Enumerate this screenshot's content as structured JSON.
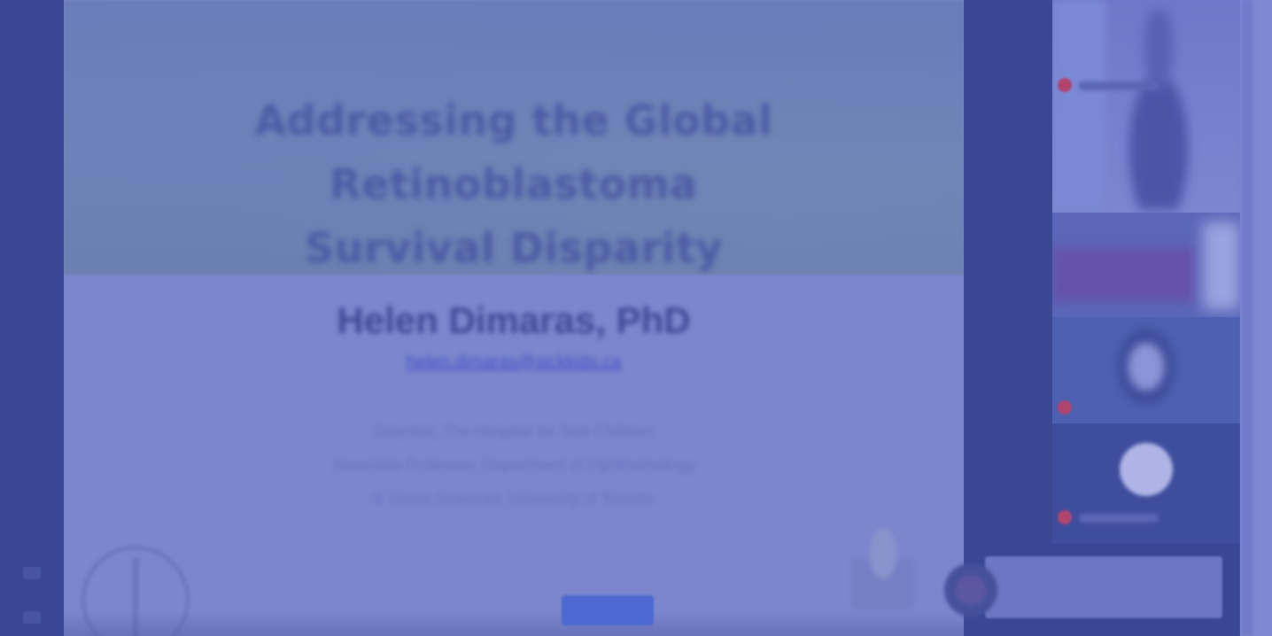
{
  "slide": {
    "title": "Addressing the Global Retinoblastoma Survival Disparity",
    "presenter_name": "Helen Dimaras, PhD",
    "presenter_email": "helen.dimaras@sickkids.ca",
    "affiliation_lines": [
      "Scientist, The Hospital for Sick Children",
      "Associate Professor, Department of Ophthalmology",
      "& Vision Sciences, University of Toronto"
    ]
  },
  "colors": {
    "overlay": "#7b86cd",
    "panel": "#3a4894",
    "accent": "#4d68d0",
    "mic_muted": "#b1436f"
  },
  "video_tiles": [
    {
      "icon": "mic-off-icon"
    },
    {
      "icon": "none"
    },
    {
      "icon": "mic-off-icon"
    },
    {
      "icon": "mic-off-icon"
    }
  ]
}
